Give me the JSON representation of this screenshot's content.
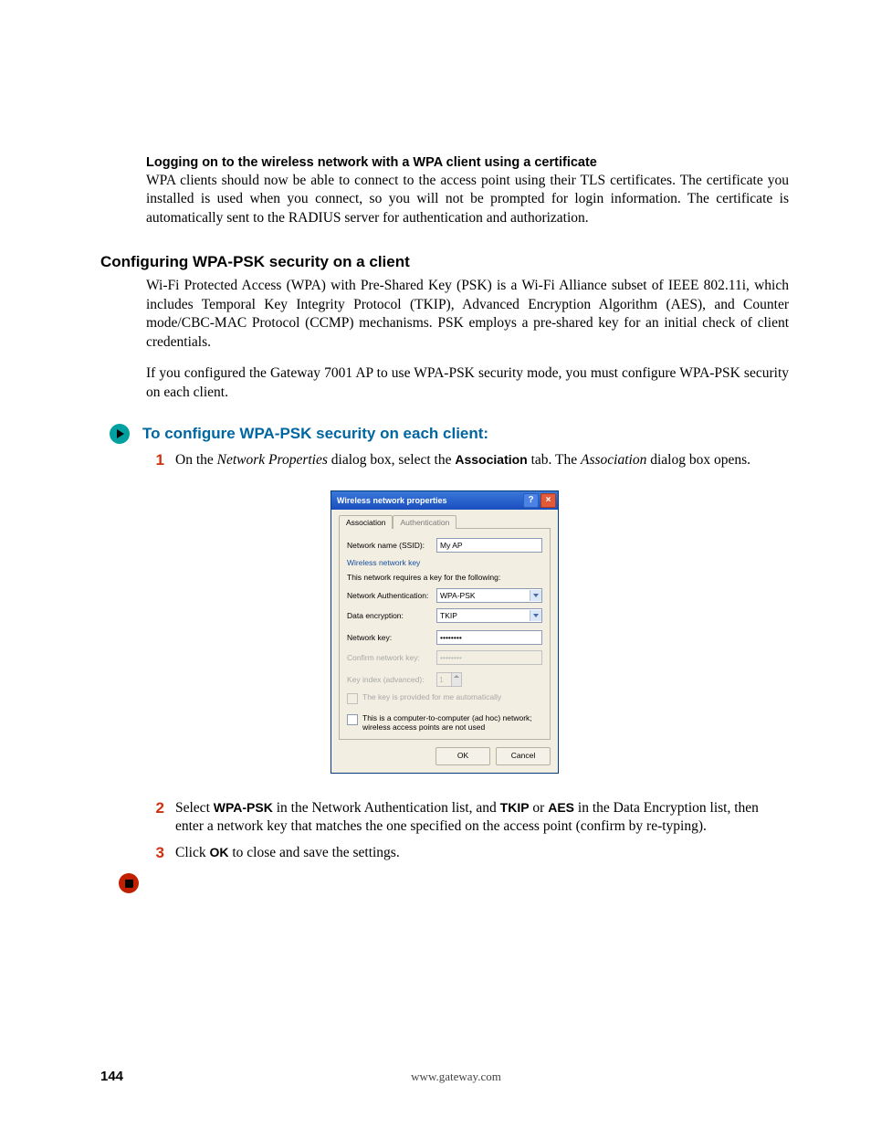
{
  "sec1_heading": "Logging on to the wireless network with a WPA client using a certificate",
  "sec1_body": "WPA clients should now be able to connect to the access point using their TLS certificates. The certificate you installed is used when you connect, so you will not be prompted for login information. The certificate is automatically sent to the RADIUS server for authentication and authorization.",
  "sec2_heading": "Configuring WPA-PSK security on a client",
  "sec2_p1": "Wi-Fi Protected Access (WPA) with Pre-Shared Key (PSK) is a Wi-Fi Alliance subset of IEEE 802.11i, which includes Temporal Key Integrity Protocol (TKIP), Advanced Encryption Algorithm (AES), and Counter mode/CBC-MAC Protocol (CCMP) mechanisms. PSK employs a pre-shared key for an initial check of client credentials.",
  "sec2_p2": "If you configured the Gateway 7001 AP to use WPA-PSK security mode, you must configure WPA-PSK security on each client.",
  "proc_heading": "To configure WPA-PSK security on each client:",
  "steps": {
    "s1_a": "On the ",
    "s1_b": "Network Properties",
    "s1_c": " dialog box, select the ",
    "s1_d": "Association",
    "s1_e": " tab. The ",
    "s1_f": "Association",
    "s1_g": " dialog box opens.",
    "s2_a": "Select ",
    "s2_b": "WPA-PSK",
    "s2_c": " in the Network Authentication list, and ",
    "s2_d": "TKIP",
    "s2_e": " or ",
    "s2_f": "AES",
    "s2_g": " in the Data Encryption list, then enter a network key that matches the one specified on the access point (confirm by re-typing).",
    "s3_a": "Click ",
    "s3_b": "OK",
    "s3_c": " to close and save the settings."
  },
  "dialog": {
    "title": "Wireless network properties",
    "tab_assoc": "Association",
    "tab_auth": "Authentication",
    "lbl_ssid": "Network name (SSID):",
    "val_ssid": "My AP",
    "group": "Wireless network key",
    "hint": "This network requires a key for the following:",
    "lbl_auth": "Network Authentication:",
    "val_auth": "WPA-PSK",
    "lbl_enc": "Data encryption:",
    "val_enc": "TKIP",
    "lbl_key": "Network key:",
    "val_key": "••••••••",
    "lbl_confirm": "Confirm network key:",
    "val_confirm": "••••••••",
    "lbl_index": "Key index (advanced):",
    "val_index": "1",
    "chk_auto": "The key is provided for me automatically",
    "chk_adhoc": "This is a computer-to-computer (ad hoc) network; wireless access points are not used",
    "btn_ok": "OK",
    "btn_cancel": "Cancel"
  },
  "page_number": "144",
  "footer_url": "www.gateway.com"
}
